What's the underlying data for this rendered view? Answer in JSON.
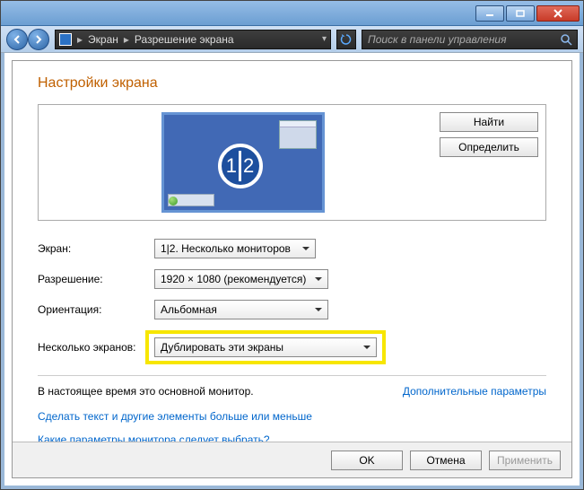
{
  "breadcrumb": {
    "item1": "Экран",
    "item2": "Разрешение экрана"
  },
  "search": {
    "placeholder": "Поиск в панели управления"
  },
  "page": {
    "title": "Настройки экрана"
  },
  "preview": {
    "badge_left": "1",
    "badge_right": "2"
  },
  "buttons": {
    "find": "Найти",
    "identify": "Определить",
    "ok": "OK",
    "cancel": "Отмена",
    "apply": "Применить"
  },
  "labels": {
    "screen": "Экран:",
    "resolution": "Разрешение:",
    "orientation": "Ориентация:",
    "multiple": "Несколько экранов:"
  },
  "values": {
    "screen": "1|2. Несколько мониторов",
    "resolution": "1920 × 1080 (рекомендуется)",
    "orientation": "Альбомная",
    "multiple": "Дублировать эти экраны"
  },
  "status": {
    "main_monitor": "В настоящее время это основной монитор.",
    "advanced": "Дополнительные параметры"
  },
  "links": {
    "text_size": "Сделать текст и другие элементы больше или меньше",
    "which_settings": "Какие параметры монитора следует выбрать?"
  }
}
